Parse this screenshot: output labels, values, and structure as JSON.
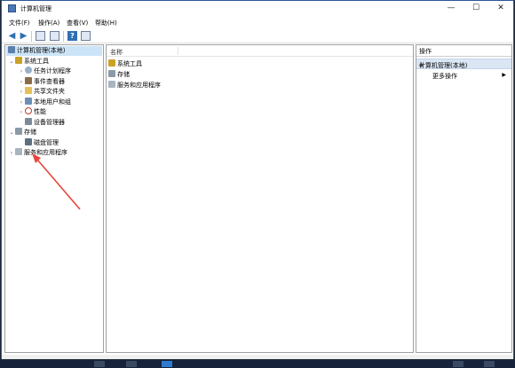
{
  "window": {
    "title": "计算机管理",
    "controls": {
      "minimize": "—",
      "maximize": "☐",
      "close": "✕"
    }
  },
  "menu": [
    "文件(F)",
    "操作(A)",
    "查看(V)",
    "帮助(H)"
  ],
  "toolbar": {
    "help": "?"
  },
  "tree": {
    "root": "计算机管理(本地)",
    "items": [
      {
        "label": "系统工具",
        "icon": "tools-icon",
        "expander": "⌄"
      },
      {
        "label": "任务计划程序",
        "icon": "clock-icon",
        "expander": "›"
      },
      {
        "label": "事件查看器",
        "icon": "event-viewer-icon",
        "expander": "›"
      },
      {
        "label": "共享文件夹",
        "icon": "shared-folder-icon",
        "expander": "›"
      },
      {
        "label": "本地用户和组",
        "icon": "users-icon",
        "expander": "›"
      },
      {
        "label": "性能",
        "icon": "performance-icon",
        "expander": "›"
      },
      {
        "label": "设备管理器",
        "icon": "device-manager-icon",
        "expander": ""
      },
      {
        "label": "存储",
        "icon": "storage-icon",
        "expander": "⌄"
      },
      {
        "label": "磁盘管理",
        "icon": "disk-icon",
        "expander": ""
      },
      {
        "label": "服务和应用程序",
        "icon": "services-icon",
        "expander": "›"
      }
    ]
  },
  "list": {
    "column": "名称",
    "rows": [
      "系统工具",
      "存储",
      "服务和应用程序"
    ]
  },
  "actions": {
    "header": "操作",
    "section": "计算机管理(本地)",
    "collapse": "▲",
    "item": "更多操作",
    "item_arrow": "▶"
  },
  "colors": {
    "accent": "#2b579a",
    "selection": "#cce4f7",
    "annotation_arrow": "#e8453c"
  }
}
